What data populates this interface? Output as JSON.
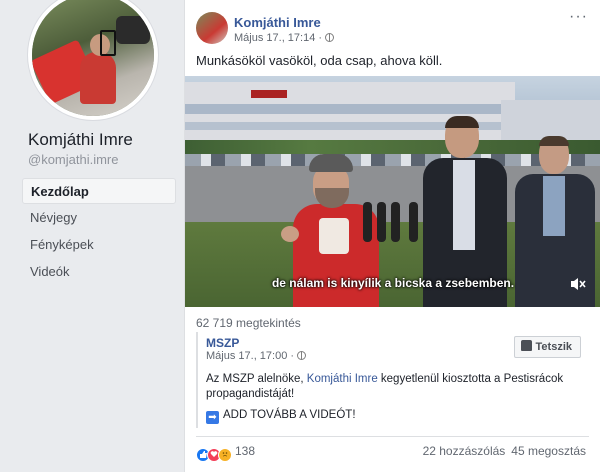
{
  "profile": {
    "name": "Komjáthi Imre",
    "handle": "@komjathi.imre"
  },
  "nav": {
    "items": [
      {
        "label": "Kezdőlap",
        "active": true
      },
      {
        "label": "Névjegy",
        "active": false
      },
      {
        "label": "Fényképek",
        "active": false
      },
      {
        "label": "Videók",
        "active": false
      }
    ]
  },
  "post": {
    "author": "Komjáthi Imre",
    "timestamp": "Május 17., 17:14 ·",
    "text": "Munkásököl vasököl, oda csap, ahova köll.",
    "more_icon": "···",
    "video": {
      "subtitle": "de nálam is kinyílik a bicska a zsebemben.",
      "mute_icon": "speaker-muted-icon"
    },
    "views": "62 719 megtekintés",
    "shared": {
      "author": "MSZP",
      "timestamp": "Május 17., 17:00 ·",
      "like_label": "Tetszik",
      "text_before": "Az MSZP alelnöke, ",
      "text_link": "Komjáthi Imre",
      "text_after": " kegyetlenül kiosztotta a Pestisrácok propagandistáját!",
      "cta_icon": "➡",
      "cta": "ADD TOVÁBB A VIDEÓT!"
    },
    "reactions": {
      "count": "138",
      "types": [
        "like",
        "love",
        "sad"
      ]
    },
    "comments": "22 hozzászólás",
    "shares": "45 megosztás"
  },
  "colors": {
    "link": "#385898",
    "page_bg": "#e9ebee",
    "reaction_like": "#1877f2",
    "reaction_love": "#f33e58",
    "reaction_sad": "#f7b125"
  }
}
